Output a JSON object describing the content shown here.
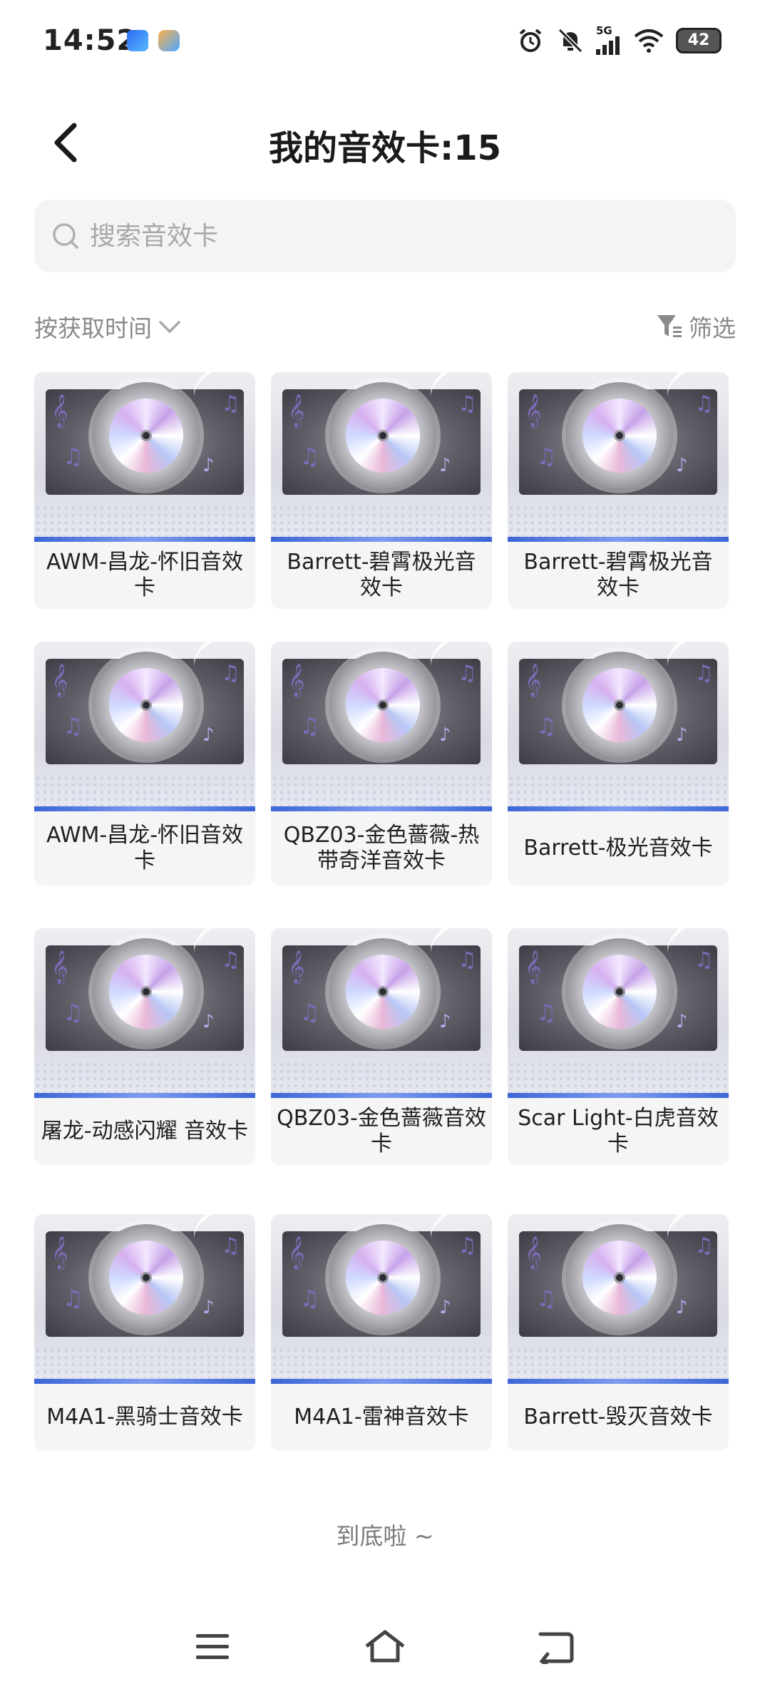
{
  "status_bar": {
    "time": "14:52",
    "network": "5G",
    "battery": "42",
    "icons": [
      "alarm-icon",
      "mute-icon",
      "signal-icon",
      "wifi-icon",
      "battery-icon"
    ]
  },
  "header": {
    "title": "我的音效卡:15",
    "back_icon": "chevron-left-icon"
  },
  "search": {
    "placeholder": "搜索音效卡",
    "value": ""
  },
  "sort": {
    "label": "按获取时间",
    "filter_label": "筛选"
  },
  "cards": [
    {
      "label": "AWM-昌龙-怀旧音效卡"
    },
    {
      "label": "Barrett-碧霄极光音效卡"
    },
    {
      "label": "Barrett-碧霄极光音效卡"
    },
    {
      "label": "AWM-昌龙-怀旧音效卡"
    },
    {
      "label": "QBZ03-金色蔷薇-热带奇洋音效卡"
    },
    {
      "label": "Barrett-极光音效卡"
    },
    {
      "label": "屠龙-动感闪耀 音效卡"
    },
    {
      "label": "QBZ03-金色蔷薇音效卡"
    },
    {
      "label": "Scar Light-白虎音效卡"
    },
    {
      "label": "M4A1-黑骑士音效卡"
    },
    {
      "label": "M4A1-雷神音效卡"
    },
    {
      "label": "Barrett-毁灭音效卡"
    }
  ],
  "footer": {
    "end_text": "到底啦 ~"
  },
  "nav": [
    "menu-icon",
    "home-icon",
    "back-icon"
  ]
}
